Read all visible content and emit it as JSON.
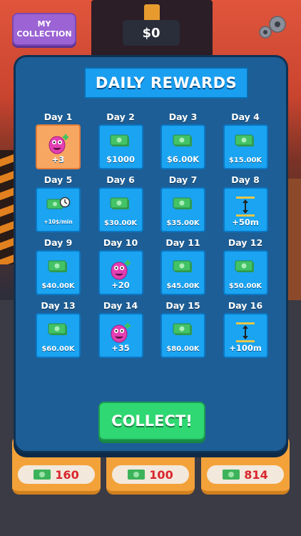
{
  "top_bar": {
    "collection_label_line1": "MY",
    "collection_label_line2": "COLLECTION",
    "money": "$0"
  },
  "modal": {
    "title": "DAILY REWARDS",
    "collect_label": "COLLECT!",
    "days": [
      {
        "day": "Day 1",
        "reward": "+3",
        "icon": "monster-icon",
        "claimed": true
      },
      {
        "day": "Day 2",
        "reward": "$1000",
        "icon": "cash-icon"
      },
      {
        "day": "Day 3",
        "reward": "$6.00K",
        "icon": "cash-icon"
      },
      {
        "day": "Day 4",
        "reward": "$15.00K",
        "icon": "cash-icon"
      },
      {
        "day": "Day 5",
        "reward": "+10$/min",
        "icon": "cash-timer-icon"
      },
      {
        "day": "Day 6",
        "reward": "$30.00K",
        "icon": "cash-icon"
      },
      {
        "day": "Day 7",
        "reward": "$35.00K",
        "icon": "cash-icon"
      },
      {
        "day": "Day 8",
        "reward": "+50m",
        "icon": "height-icon"
      },
      {
        "day": "Day 9",
        "reward": "$40.00K",
        "icon": "cash-icon"
      },
      {
        "day": "Day 10",
        "reward": "+20",
        "icon": "monster-icon"
      },
      {
        "day": "Day 11",
        "reward": "$45.00K",
        "icon": "cash-icon"
      },
      {
        "day": "Day 12",
        "reward": "$50.00K",
        "icon": "cash-icon"
      },
      {
        "day": "Day 13",
        "reward": "$60.00K",
        "icon": "cash-icon"
      },
      {
        "day": "Day 14",
        "reward": "+35",
        "icon": "monster-icon"
      },
      {
        "day": "Day 15",
        "reward": "$80.00K",
        "icon": "cash-icon"
      },
      {
        "day": "Day 16",
        "reward": "+100m",
        "icon": "height-icon"
      }
    ]
  },
  "bottom_cards": [
    {
      "value": "160"
    },
    {
      "value": "100"
    },
    {
      "value": "814"
    }
  ],
  "colors": {
    "modal_bg": "#1d5e96",
    "cell_bg": "#1aa4f2",
    "claimed_bg": "#f8a762",
    "collect_bg": "#2fd872",
    "collection_btn": "#9b63d4"
  }
}
